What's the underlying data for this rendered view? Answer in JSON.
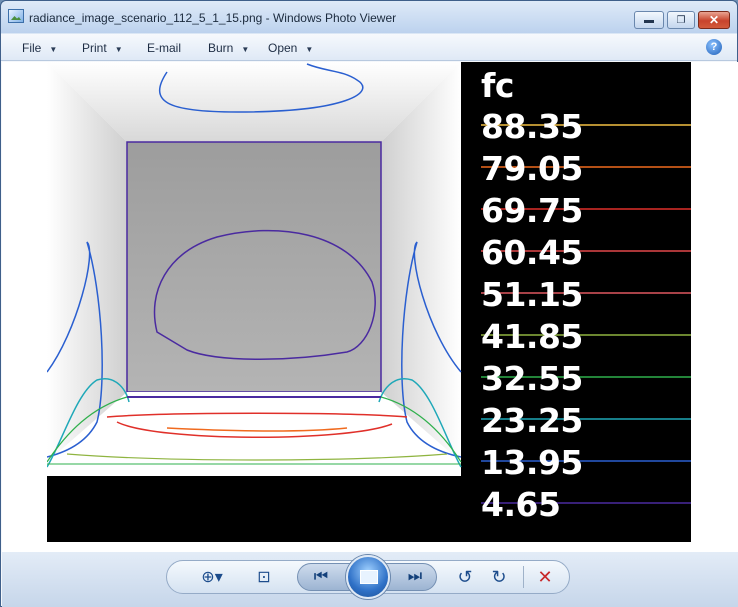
{
  "window": {
    "title": "radiance_image_scenario_112_5_1_15.png - Windows Photo Viewer",
    "minimize_glyph": "▬",
    "maximize_glyph": "❐",
    "close_glyph": "✕"
  },
  "menu": {
    "file": "File",
    "print": "Print",
    "email": "E-mail",
    "burn": "Burn",
    "open": "Open",
    "arrow": "▼",
    "help": "?"
  },
  "legend": {
    "unit": "fc",
    "values": [
      "88.35",
      "79.05",
      "69.75",
      "60.45",
      "51.15",
      "41.85",
      "32.55",
      "23.25",
      "13.95",
      "4.65"
    ],
    "colors": [
      "#f2c043",
      "#f06a1e",
      "#e0302a",
      "#e2484a",
      "#e05860",
      "#8fb440",
      "#2fb04c",
      "#1fa8b8",
      "#2a5fd0",
      "#4a2aa0"
    ]
  },
  "toolbar": {
    "zoom_glyph": "⊕▾",
    "fit_glyph": "⊡",
    "prev_glyph": "⏮",
    "next_glyph": "⏭",
    "rotate_left_glyph": "↺",
    "rotate_right_glyph": "↻",
    "delete_glyph": "✕"
  },
  "colors": {
    "accent": "#1c4c8c",
    "delete": "#c8282a"
  }
}
